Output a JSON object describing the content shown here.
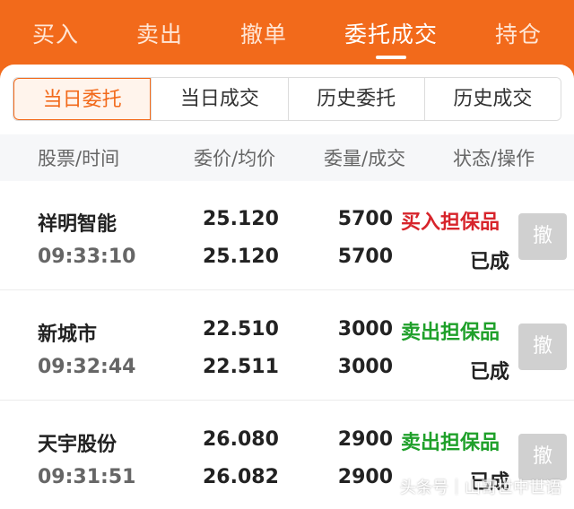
{
  "top_tabs": [
    {
      "label": "买入"
    },
    {
      "label": "卖出"
    },
    {
      "label": "撤单"
    },
    {
      "label": "委托成交"
    },
    {
      "label": "持仓"
    }
  ],
  "segment": [
    {
      "label": "当日委托"
    },
    {
      "label": "当日成交"
    },
    {
      "label": "历史委托"
    },
    {
      "label": "历史成交"
    }
  ],
  "columns": {
    "stock_time": "股票/时间",
    "price": "委价/均价",
    "qty": "委量/成交",
    "status": "状态/操作"
  },
  "orders": [
    {
      "name": "祥明智能",
      "time": "09:33:10",
      "order_price": "25.120",
      "avg_price": "25.120",
      "order_qty": "5700",
      "filled_qty": "5700",
      "type": "买入担保品",
      "status": "已成",
      "cancel": "撤"
    },
    {
      "name": "新城市",
      "time": "09:32:44",
      "order_price": "22.510",
      "avg_price": "22.511",
      "order_qty": "3000",
      "filled_qty": "3000",
      "type": "卖出担保品",
      "status": "已成",
      "cancel": "撤"
    },
    {
      "name": "天宇股份",
      "time": "09:31:51",
      "order_price": "26.080",
      "avg_price": "26.082",
      "order_qty": "2900",
      "filled_qty": "2900",
      "type": "卖出担保品",
      "status": "已成",
      "cancel": "撤"
    }
  ],
  "watermark": "头条号｜山哥世中世语",
  "colors": {
    "brand": "#f26a1b",
    "buy": "#d7242b",
    "sell": "#1fa02a"
  }
}
